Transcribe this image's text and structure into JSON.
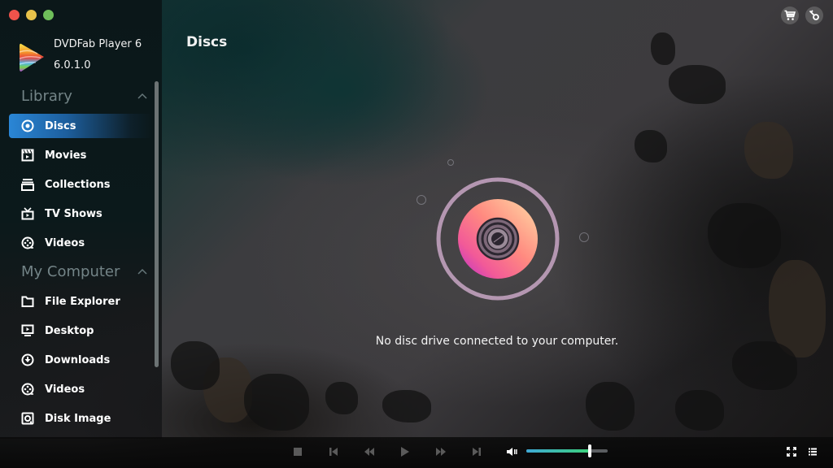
{
  "app": {
    "name": "DVDFab Player 6",
    "version": "6.0.1.0"
  },
  "window_controls": [
    "close",
    "minimize",
    "maximize"
  ],
  "sidebar": {
    "sections": [
      {
        "title": "Library",
        "expanded": true,
        "items": [
          {
            "label": "Discs",
            "icon": "disc-icon",
            "active": true
          },
          {
            "label": "Movies",
            "icon": "clapperboard-icon",
            "active": false
          },
          {
            "label": "Collections",
            "icon": "collections-icon",
            "active": false
          },
          {
            "label": "TV Shows",
            "icon": "tv-icon",
            "active": false
          },
          {
            "label": "Videos",
            "icon": "film-reel-icon",
            "active": false
          }
        ]
      },
      {
        "title": "My Computer",
        "expanded": true,
        "items": [
          {
            "label": "File Explorer",
            "icon": "folder-icon",
            "active": false
          },
          {
            "label": "Desktop",
            "icon": "desktop-icon",
            "active": false
          },
          {
            "label": "Downloads",
            "icon": "download-icon",
            "active": false
          },
          {
            "label": "Videos",
            "icon": "film-reel-icon",
            "active": false
          },
          {
            "label": "Disk Image",
            "icon": "disk-image-icon",
            "active": false
          }
        ]
      }
    ]
  },
  "header": {
    "title": "Discs",
    "icons": [
      "cart-icon",
      "key-icon"
    ]
  },
  "main": {
    "empty_message": "No disc drive connected to your computer.",
    "disc_colors": {
      "start": "#ffcf9a",
      "mid": "#ff7a86",
      "end": "#c234c8",
      "ring": "#c9a3c0"
    }
  },
  "player": {
    "controls": [
      "stop-icon",
      "skip-previous-icon",
      "rewind-icon",
      "play-icon",
      "fast-forward-icon",
      "skip-next-icon"
    ],
    "volume_percent": 78,
    "volume_gradient": [
      "#3fa9d6",
      "#3bd17a"
    ],
    "right_icons": [
      "fullscreen-icon",
      "playlist-icon"
    ]
  },
  "colors": {
    "active_nav": "#2a86d6",
    "section_title": "#738487"
  }
}
